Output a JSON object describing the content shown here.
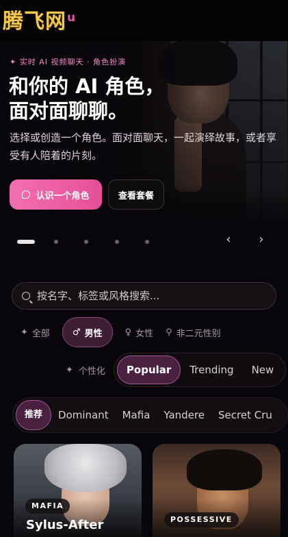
{
  "watermark": "腾飞网",
  "brand_fragment": "u",
  "hero": {
    "eyebrow": "✦ 实时 AI 视频聊天 · 角色扮演",
    "headline_line1": "和你的 AI 角色，",
    "headline_line2": "面对面聊聊。",
    "description": "选择或创造一个角色。面对面聊天，一起演绎故事，或者享受有人陪着的片刻。",
    "primary_button": "认识一个角色",
    "secondary_button": "查看套餐",
    "prev_icon": "chevron-left-icon",
    "next_icon": "chevron-right-icon",
    "carousel_dots": 5,
    "carousel_active_index": 0
  },
  "search": {
    "placeholder": "按名字、标签或风格搜索..."
  },
  "gender_filter": {
    "items": [
      {
        "icon": "✦",
        "label": "全部"
      },
      {
        "icon": "♂",
        "label": "男性"
      },
      {
        "icon": "♀",
        "label": "女性"
      },
      {
        "icon": "⚲",
        "label": "非二元性别"
      }
    ],
    "selected": "男性"
  },
  "sort": {
    "label": "个性化",
    "options": [
      "Popular",
      "Trending",
      "New"
    ],
    "selected": "Popular"
  },
  "tags": {
    "items": [
      "推荐",
      "Dominant",
      "Mafia",
      "Yandere",
      "Secret Cru"
    ],
    "selected": "推荐"
  },
  "cards": [
    {
      "badge": "MAFIA",
      "title": "Sylus-After"
    },
    {
      "badge": "POSSESSIVE",
      "title": ""
    }
  ],
  "colors": {
    "accent_pink": "#e64f96",
    "chip_active_bg": "#4a2040",
    "watermark_gold": "#f3c94a"
  }
}
